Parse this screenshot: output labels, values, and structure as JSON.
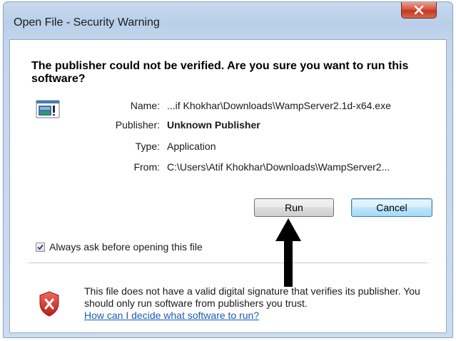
{
  "window": {
    "title": "Open File - Security Warning",
    "close_label": "x"
  },
  "dialog": {
    "heading": "The publisher could not be verified.  Are you sure you want to run this software?",
    "app_icon": "application-icon",
    "fields": [
      {
        "label": "Name:",
        "value": "...if Khokhar\\Downloads\\WampServer2.1d-x64.exe"
      },
      {
        "label": "Publisher:",
        "value": "Unknown Publisher"
      },
      {
        "label": "Type:",
        "value": "Application"
      },
      {
        "label": "From:",
        "value": "C:\\Users\\Atif Khokhar\\Downloads\\WampServer2..."
      }
    ],
    "buttons": {
      "run": "Run",
      "cancel": "Cancel"
    },
    "checkbox": {
      "label": "Always ask before opening this file",
      "checked": true
    },
    "warning": {
      "icon": "shield-x-icon",
      "text": "This file does not have a valid digital signature that verifies its publisher.  You should only run software from publishers you trust.",
      "link": "How can I decide what software to run?"
    }
  },
  "annotation": {
    "arrow_icon": "up-arrow-icon"
  },
  "colors": {
    "link": "#1a5db5",
    "close_button": "#c23a20",
    "shield": "#d8302a",
    "default_button_border": "#3c7fb1"
  }
}
